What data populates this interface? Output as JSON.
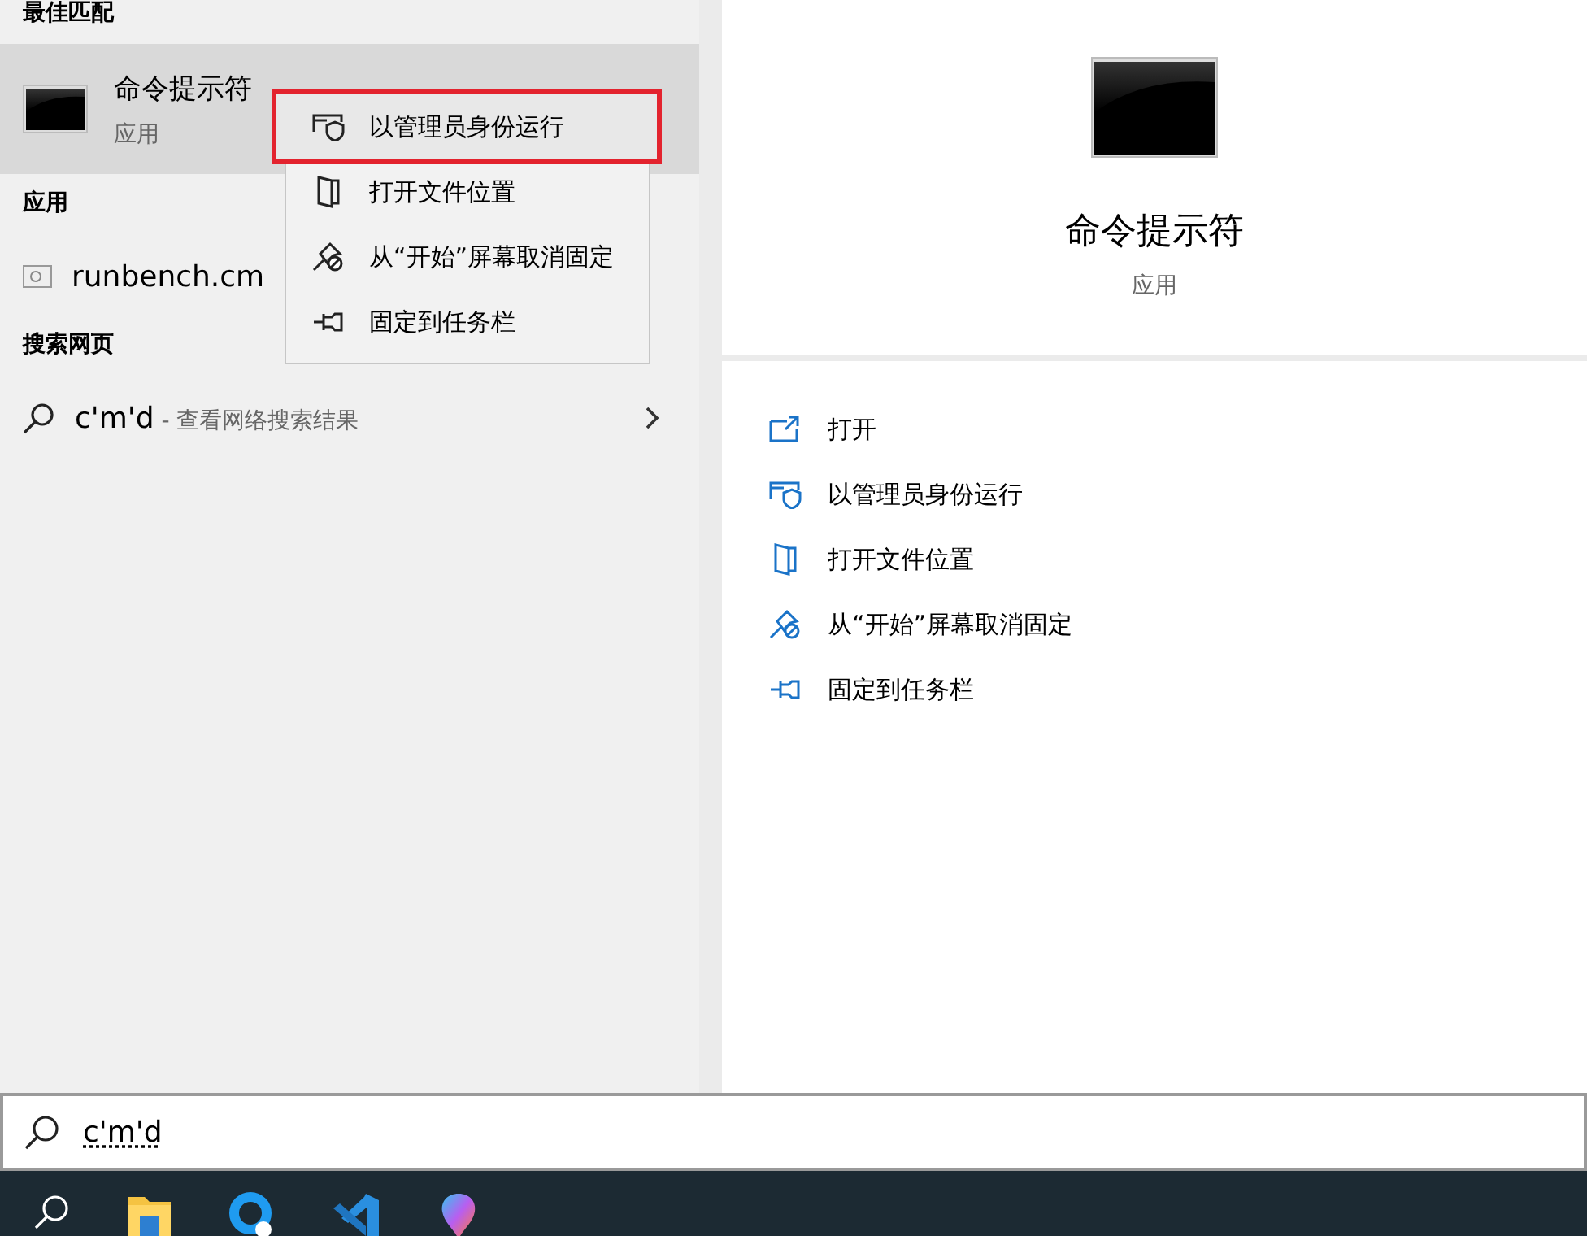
{
  "best_match": {
    "heading": "最佳匹配",
    "title": "命令提示符",
    "subtitle": "应用",
    "selected": true
  },
  "apps": {
    "heading": "应用",
    "items": [
      {
        "name": "runbench.cm"
      }
    ]
  },
  "web_search": {
    "heading": "搜索网页",
    "query": "c'm'd",
    "hint": "- 查看网络搜索结果"
  },
  "context_menu": [
    {
      "kind": "admin",
      "label": "以管理员身份运行",
      "highlighted": true
    },
    {
      "kind": "location",
      "label": "打开文件位置",
      "highlighted": false
    },
    {
      "kind": "unpin",
      "label": "从“开始”屏幕取消固定",
      "highlighted": false
    },
    {
      "kind": "pin",
      "label": "固定到任务栏",
      "highlighted": false
    }
  ],
  "detail": {
    "title": "命令提示符",
    "subtitle": "应用",
    "actions": [
      {
        "kind": "open",
        "label": "打开"
      },
      {
        "kind": "admin",
        "label": "以管理员身份运行"
      },
      {
        "kind": "location",
        "label": "打开文件位置"
      },
      {
        "kind": "unpin",
        "label": "从“开始”屏幕取消固定"
      },
      {
        "kind": "pin",
        "label": "固定到任务栏"
      }
    ]
  },
  "search_box": {
    "value": "c'm'd"
  }
}
